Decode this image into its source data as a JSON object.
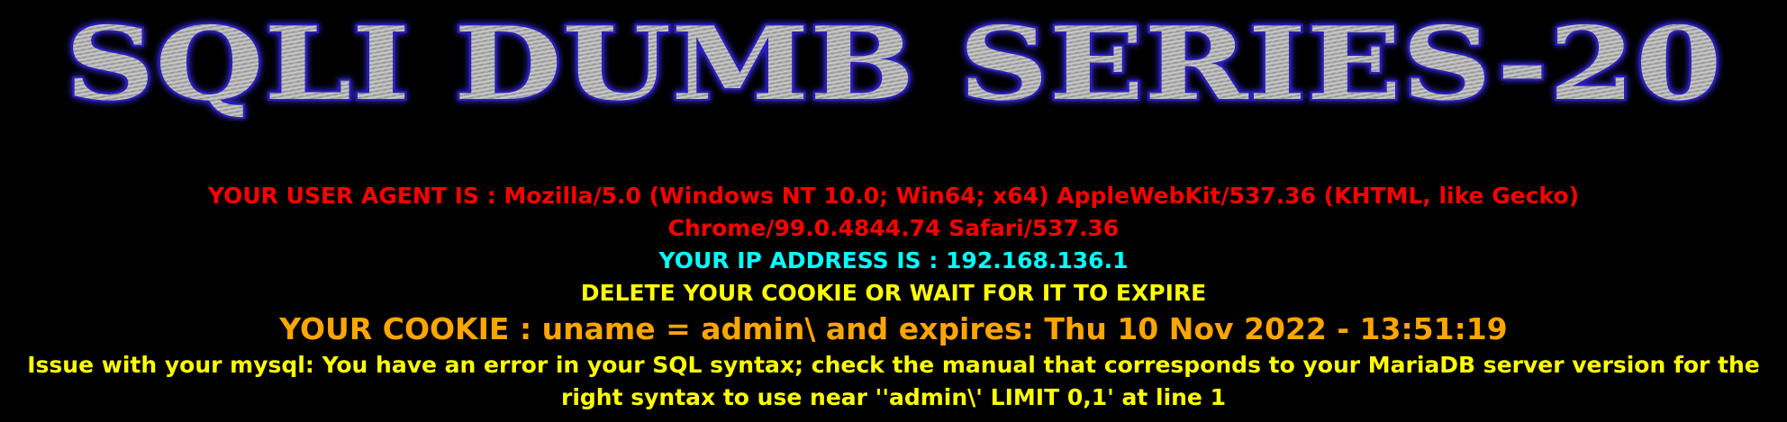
{
  "banner": {
    "title": "SQLI DUMB SERIES-20"
  },
  "messages": {
    "user_agent": "YOUR USER AGENT IS : Mozilla/5.0 (Windows NT 10.0; Win64; x64) AppleWebKit/537.36 (KHTML, like Gecko) Chrome/99.0.4844.74 Safari/537.36",
    "ip_address": "YOUR IP ADDRESS IS : 192.168.136.1",
    "delete_cookie": "DELETE YOUR COOKIE OR WAIT FOR IT TO EXPIRE",
    "cookie": "YOUR COOKIE : uname = admin\\ and expires: Thu 10 Nov 2022 - 13:51:19",
    "mysql_error": "Issue with your mysql: You have an error in your SQL syntax; check the manual that corresponds to your MariaDB server version for the right syntax to use near ''admin\\' LIMIT 0,1' at line 1"
  },
  "colors": {
    "background": "#000000",
    "user_agent": "#ff0000",
    "ip_address": "#00ffff",
    "delete_cookie": "#ffff00",
    "cookie": "#ffa500",
    "mysql_error": "#ffff00",
    "banner_fill": "#a9a9a9",
    "banner_outline": "#2b1fb8"
  }
}
